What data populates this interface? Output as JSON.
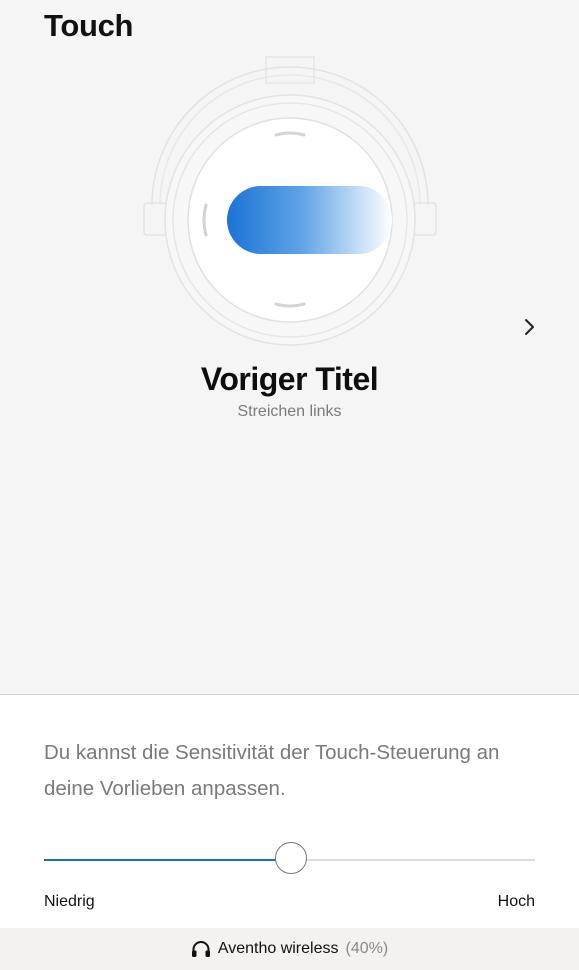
{
  "header": {
    "title": "Touch"
  },
  "gesture": {
    "title": "Voriger Titel",
    "subtitle": "Streichen links",
    "next_icon": "chevron-right-icon"
  },
  "colors": {
    "swipe_gradient_start": "#1a73d6",
    "swipe_gradient_end": "#ffffff",
    "slider_accent": "#1a6fb0"
  },
  "sensitivity": {
    "description": "Du kannst die Sensitivität der Touch-Steuerung an deine Vorlieben anpassen.",
    "low_label": "Niedrig",
    "high_label": "Hoch",
    "value_percent": 50.5
  },
  "device": {
    "icon": "headphones-icon",
    "name": "Aventho wireless",
    "battery": "(40%)"
  }
}
